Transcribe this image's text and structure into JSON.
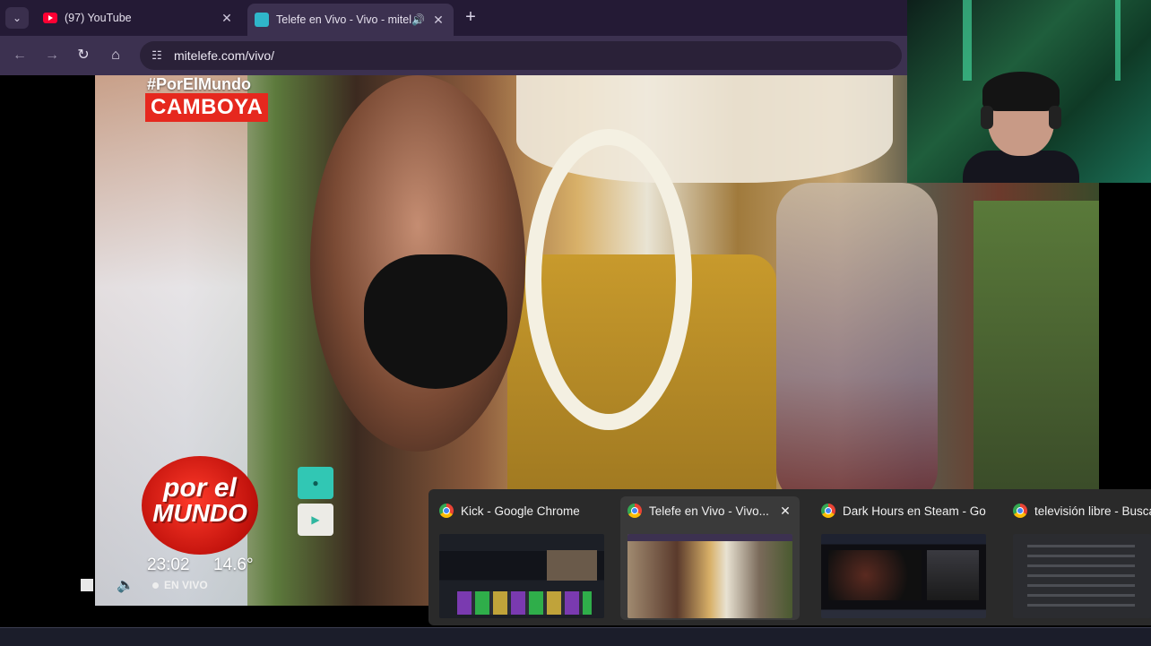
{
  "browser": {
    "tabs": [
      {
        "title": "(97) YouTube",
        "favicon": "youtube-icon"
      },
      {
        "title": "Telefe en Vivo - Vivo - mitel",
        "favicon": "telefe-icon",
        "audio": "speaker-icon"
      }
    ],
    "url": "mitelefe.com/vivo/"
  },
  "video": {
    "hashtag": "#PorElMundo",
    "country": "CAMBOYA",
    "logo_line1": "por el",
    "logo_line2": "MUNDO",
    "time": "23:02",
    "temperature": "14.6°",
    "live_label": "EN VIVO",
    "brand_color": "#e6281e"
  },
  "switcher": {
    "windows": [
      {
        "title": "Kick - Google Chrome"
      },
      {
        "title": "Telefe en Vivo - Vivo...",
        "selected": true
      },
      {
        "title": "Dark Hours en Steam - Goo..."
      },
      {
        "title": "televisión libre - Buscar"
      }
    ]
  }
}
